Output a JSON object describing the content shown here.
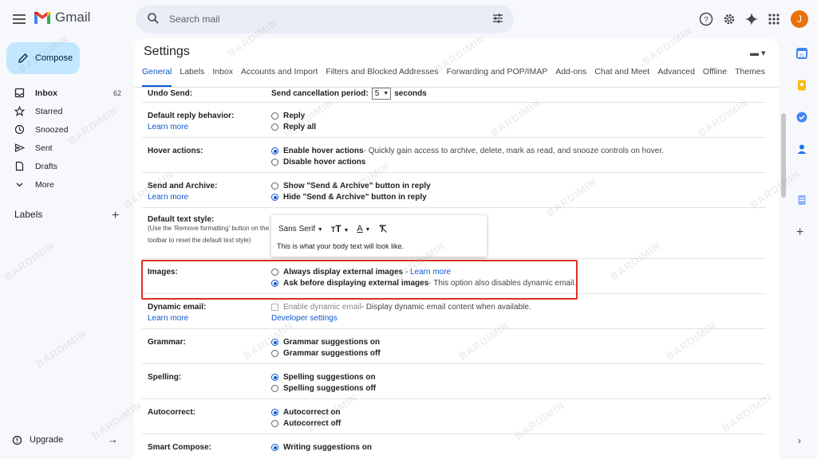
{
  "app": {
    "logo_text": "Gmail"
  },
  "search": {
    "placeholder": "Search mail"
  },
  "user": {
    "initial": "J",
    "avatar_color": "#e8710a"
  },
  "compose": {
    "label": "Compose"
  },
  "nav": {
    "items": [
      {
        "label": "Inbox",
        "count": "62",
        "icon": "inbox-icon"
      },
      {
        "label": "Starred",
        "icon": "star-icon"
      },
      {
        "label": "Snoozed",
        "icon": "clock-icon"
      },
      {
        "label": "Sent",
        "icon": "send-icon"
      },
      {
        "label": "Drafts",
        "icon": "draft-icon"
      },
      {
        "label": "More",
        "icon": "chevron-down-icon"
      }
    ],
    "labels_heading": "Labels",
    "upgrade": "Upgrade"
  },
  "settings": {
    "title": "Settings",
    "tabs": [
      "General",
      "Labels",
      "Inbox",
      "Accounts and Import",
      "Filters and Blocked Addresses",
      "Forwarding and POP/IMAP",
      "Add-ons",
      "Chat and Meet",
      "Advanced",
      "Offline",
      "Themes"
    ],
    "undo_send": {
      "label": "Undo Send:",
      "prefix": "Send cancellation period:",
      "value": "5",
      "suffix": "seconds"
    },
    "reply": {
      "label": "Default reply behavior:",
      "learn_more": "Learn more",
      "opt1": "Reply",
      "opt2": "Reply all"
    },
    "hover": {
      "label": "Hover actions:",
      "opt1": "Enable hover actions",
      "opt1_desc": " - Quickly gain access to archive, delete, mark as read, and snooze controls on hover.",
      "opt2": "Disable hover actions"
    },
    "send_archive": {
      "label": "Send and Archive:",
      "learn_more": "Learn more",
      "opt1": "Show \"Send & Archive\" button in reply",
      "opt2": "Hide \"Send & Archive\" button in reply"
    },
    "text_style": {
      "label": "Default text style:",
      "note": "(Use the 'Remove formatting' button on the toolbar to reset the default text style)",
      "font": "Sans Serif",
      "preview": "This is what your body text will look like."
    },
    "images": {
      "label": "Images:",
      "opt1": "Always display external images",
      "opt1_link": "Learn more",
      "opt2": "Ask before displaying external images",
      "opt2_desc": " - This option also disables dynamic email."
    },
    "dynamic": {
      "label": "Dynamic email:",
      "learn_more": "Learn more",
      "opt1": "Enable dynamic email",
      "opt1_desc": " - Display dynamic email content when available.",
      "dev_link": "Developer settings"
    },
    "grammar": {
      "label": "Grammar:",
      "opt1": "Grammar suggestions on",
      "opt2": "Grammar suggestions off"
    },
    "spelling": {
      "label": "Spelling:",
      "opt1": "Spelling suggestions on",
      "opt2": "Spelling suggestions off"
    },
    "autocorrect": {
      "label": "Autocorrect:",
      "opt1": "Autocorrect on",
      "opt2": "Autocorrect off"
    },
    "smart_compose": {
      "label": "Smart Compose:",
      "opt1": "Writing suggestions on"
    }
  },
  "watermark": "BARDIMIN",
  "colors": {
    "accent": "#0b57d0",
    "compose_bg": "#c2e7ff",
    "highlight": "#d93025"
  }
}
